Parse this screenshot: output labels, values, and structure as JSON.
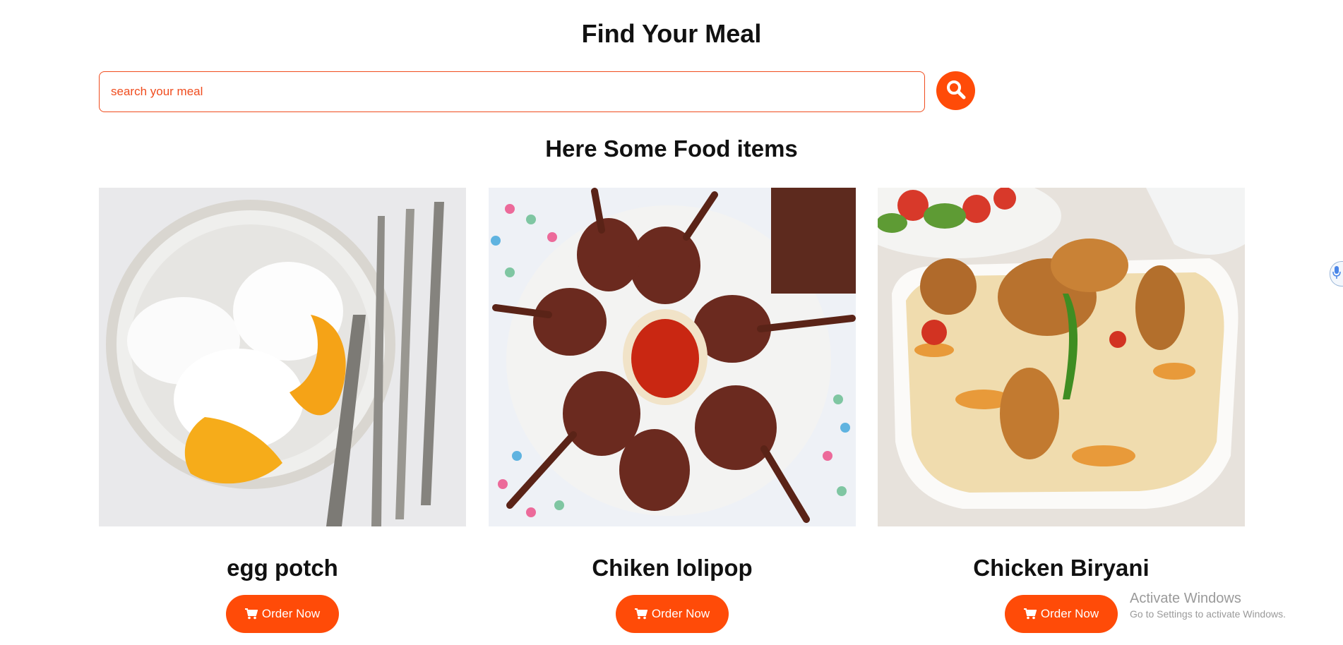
{
  "header": {
    "title": "Find Your Meal"
  },
  "search": {
    "placeholder": "search your meal",
    "value": ""
  },
  "section": {
    "title": "Here Some Food items"
  },
  "cards": [
    {
      "name": "egg potch",
      "button_label": "Order Now"
    },
    {
      "name": "Chiken lolipop",
      "button_label": "Order Now"
    },
    {
      "name": "Chicken Biryani",
      "button_label": "Order Now"
    }
  ],
  "watermark": {
    "title": "Activate Windows",
    "subtitle": "Go to Settings to activate Windows."
  },
  "icons": {
    "search": "search-icon",
    "cart": "cart-icon",
    "mic": "microphone-icon"
  },
  "colors": {
    "accent": "#ff4b08",
    "input_border": "#f04c1e",
    "text": "#111111"
  }
}
